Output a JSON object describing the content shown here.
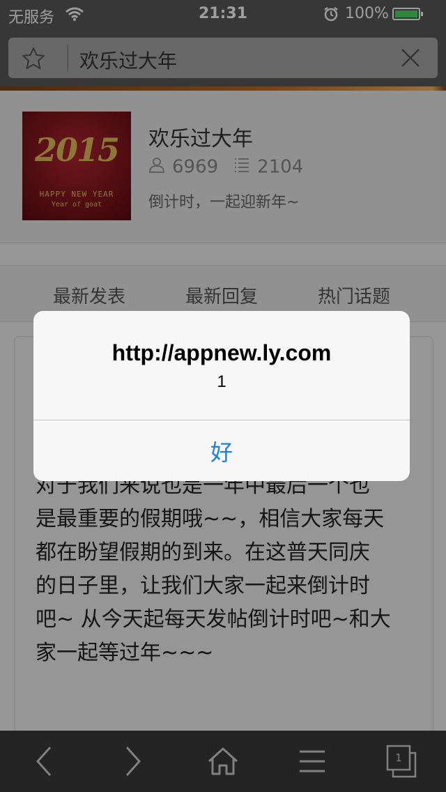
{
  "status_bar": {
    "carrier": "无服务",
    "time": "21:31",
    "battery_percent": "100%",
    "battery_level": 1.0,
    "battery_color": "#4cd964"
  },
  "search": {
    "query": "欢乐过大年",
    "icons": [
      "star-icon",
      "clear-icon"
    ]
  },
  "group": {
    "title": "欢乐过大年",
    "members": "6969",
    "posts": "2104",
    "description": "倒计时，一起迎新年~",
    "avatar_text": {
      "year": "2015",
      "line1": "HAPPY NEW YEAR",
      "line2": "Year of goat"
    }
  },
  "tabs": [
    "最新发表",
    "最新回复",
    "热门话题"
  ],
  "post": {
    "lines": [
      "对于我们来说也是一年中最后一个也",
      "是最重要的假期哦~~，相信大家每天",
      "都在盼望假期的到来。在这普天同庆",
      "的日子里，让我们大家一起来倒计时",
      "吧~  从今天起每天发帖倒计时吧~和大",
      "家一起等过年~~~"
    ]
  },
  "alert": {
    "title": "http://appnew.ly.com",
    "message": "1",
    "button": "好",
    "button_color": "#1a7ee6"
  },
  "toolbar": {
    "tab_count": "1",
    "icons": [
      "back-icon",
      "forward-icon",
      "home-icon",
      "menu-icon",
      "tabs-icon"
    ]
  },
  "colors": {
    "accent_orange": "#c8691b"
  }
}
